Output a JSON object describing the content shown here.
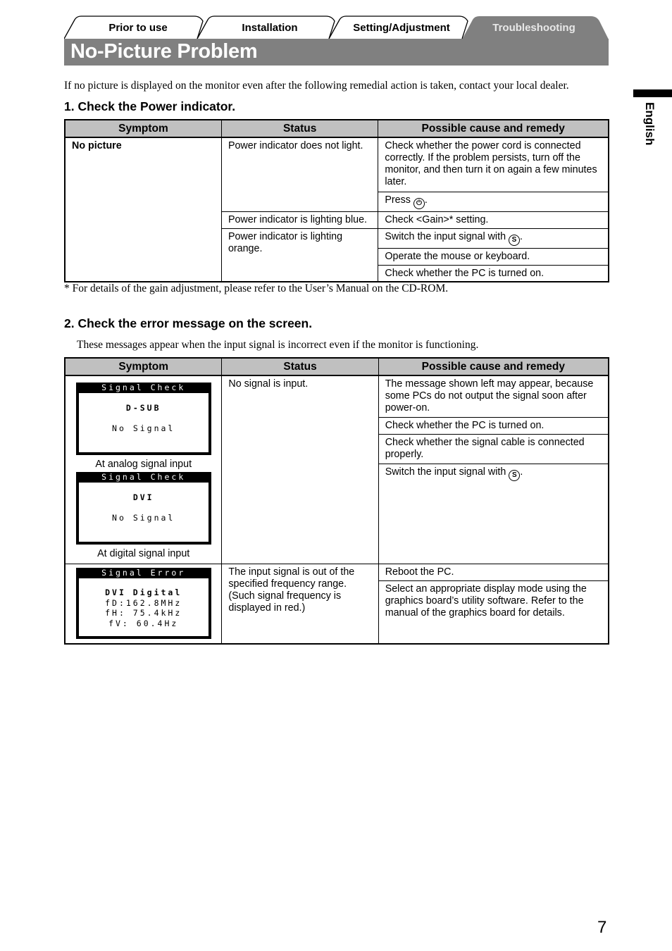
{
  "tabs": [
    {
      "label": "Prior to use",
      "active": false
    },
    {
      "label": "Installation",
      "active": false
    },
    {
      "label": "Setting/Adjustment",
      "active": false
    },
    {
      "label": "Troubleshooting",
      "active": true
    }
  ],
  "page_title": "No-Picture Problem",
  "side_label": "English",
  "intro": "If no picture is displayed on the monitor even after the following remedial action is taken, contact your local dealer.",
  "section1": {
    "heading": "1. Check the Power indicator.",
    "table": {
      "headers": [
        "Symptom",
        "Status",
        "Possible cause and remedy"
      ],
      "symptom": "No picture",
      "rows": [
        {
          "status": "Power indicator does not light.",
          "remedies": [
            "Check whether the power cord is connected correctly. If the problem persists, turn off the monitor, and then turn it on again a few minutes later.",
            "Press"
          ]
        },
        {
          "status": "Power indicator is lighting blue.",
          "remedies": [
            "Check <Gain>* setting."
          ]
        },
        {
          "status": "Power indicator is lighting orange.",
          "remedies": [
            "Switch the input signal with",
            "Operate the mouse or keyboard.",
            "Check whether the PC is turned on."
          ]
        }
      ],
      "icons": {
        "power": "power-icon",
        "power_glyph": "⏻",
        "signal": "s-button-icon",
        "signal_glyph": "S"
      },
      "period": "."
    },
    "footnote": "* For details of the gain adjustment, please refer to the User’s Manual on the CD-ROM."
  },
  "section2": {
    "heading": "2. Check the error message on the screen.",
    "intro": "These messages appear when the input signal is incorrect even if the monitor is functioning.",
    "table": {
      "headers": [
        "Symptom",
        "Status",
        "Possible cause and remedy"
      ],
      "row1": {
        "osd_analog": {
          "title": "Signal Check",
          "lines": [
            "D-SUB",
            "No Signal"
          ],
          "caption": "At analog signal input"
        },
        "osd_digital": {
          "title": "Signal Check",
          "lines": [
            "DVI",
            "No Signal"
          ],
          "caption": "At digital signal input"
        },
        "status": "No signal is input.",
        "remedies": [
          "The message shown left may appear, because some PCs do not output the signal soon after power-on.",
          "Check whether the PC is turned on.",
          "Check whether the signal cable is connected properly.",
          "Switch the input signal with"
        ]
      },
      "row2": {
        "osd_error": {
          "title": "Signal Error",
          "lines": [
            "DVI Digital",
            "fD:162.8MHz",
            "fH: 75.4kHz",
            "fV: 60.4Hz"
          ]
        },
        "status": "The input signal is out of the specified frequency range. (Such signal frequency is displayed in red.)",
        "remedies": [
          "Reboot the PC.",
          "Select an appropriate display mode using the graphics board’s utility software. Refer to the manual of the graphics board for details."
        ]
      }
    }
  },
  "page_number": "7"
}
